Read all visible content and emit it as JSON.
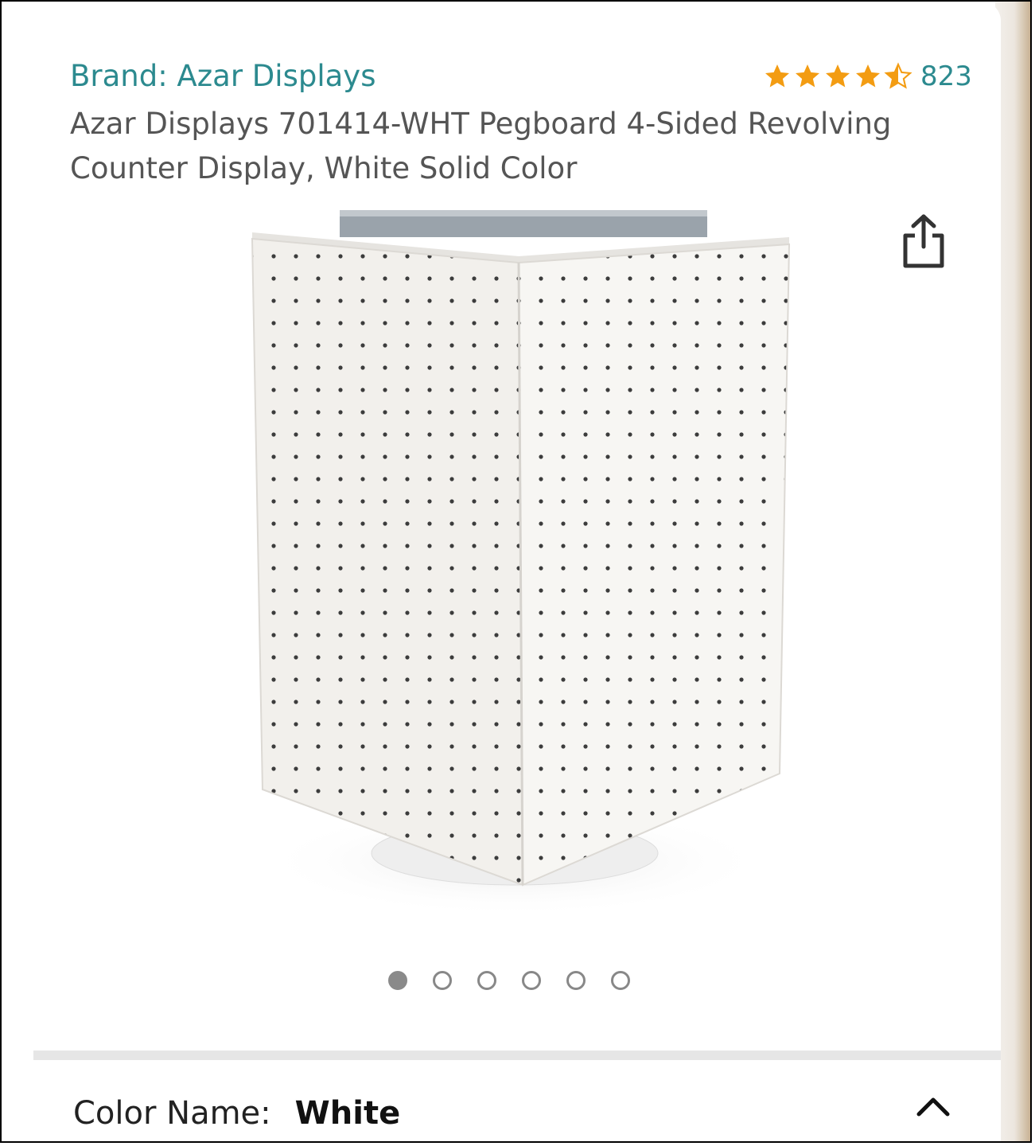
{
  "header": {
    "brand_label": "Brand: Azar Displays",
    "rating": 4.5,
    "rating_count": "823",
    "title": "Azar Displays 701414-WHT Pegboard 4-Sided Revolving Counter Display, White Solid Color"
  },
  "carousel": {
    "total": 6,
    "active_index": 0
  },
  "options": {
    "color_label": "Color Name:",
    "color_value": "White"
  },
  "colors": {
    "brand_link": "#2c8a8f",
    "star": "#f39c12"
  },
  "icons": {
    "share": "share-icon",
    "collapse": "chevron-up-icon"
  }
}
